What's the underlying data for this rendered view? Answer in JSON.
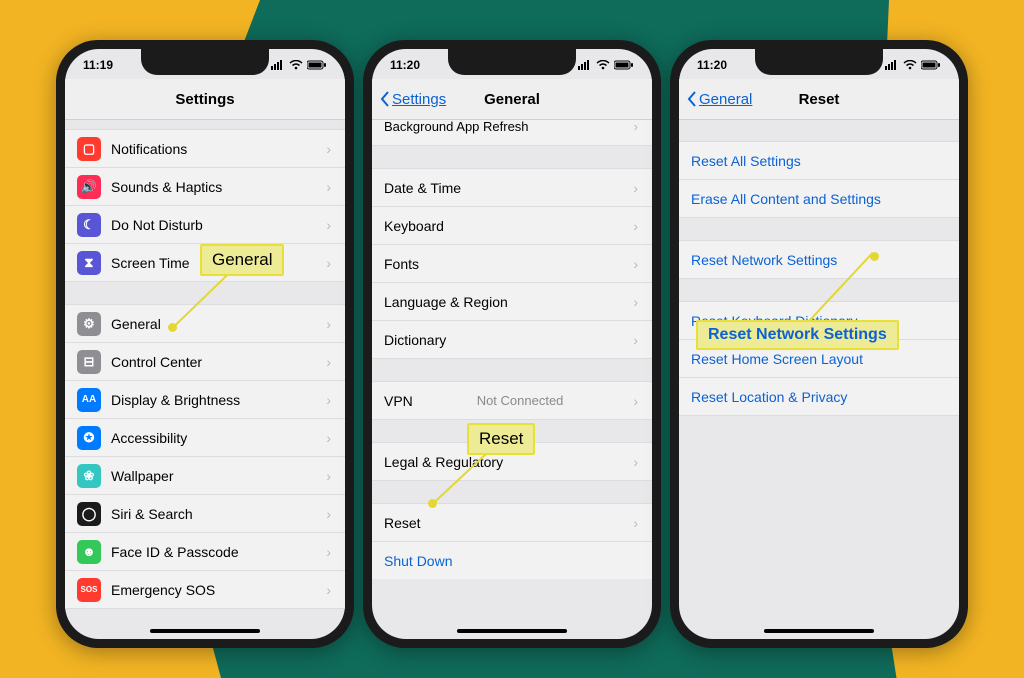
{
  "phone1": {
    "time": "11:19",
    "title": "Settings",
    "groupA": [
      {
        "label": "Notifications",
        "iconColor": "#ff3b30",
        "glyph": "◻"
      },
      {
        "label": "Sounds & Haptics",
        "iconColor": "#ff2d55",
        "glyph": "♪"
      },
      {
        "label": "Do Not Disturb",
        "iconColor": "#5856d6",
        "glyph": "☾"
      },
      {
        "label": "Screen Time",
        "iconColor": "#5856d6",
        "glyph": "⧗"
      }
    ],
    "groupB": [
      {
        "label": "General",
        "iconColor": "#8e8e93",
        "glyph": "⚙"
      },
      {
        "label": "Control Center",
        "iconColor": "#8e8e93",
        "glyph": "⊟"
      },
      {
        "label": "Display & Brightness",
        "iconColor": "#007aff",
        "glyph": "AA"
      },
      {
        "label": "Accessibility",
        "iconColor": "#007aff",
        "glyph": "✪"
      },
      {
        "label": "Wallpaper",
        "iconColor": "#34c7c2",
        "glyph": "❀"
      },
      {
        "label": "Siri & Search",
        "iconColor": "#1b1b1c",
        "glyph": "◯"
      },
      {
        "label": "Face ID & Passcode",
        "iconColor": "#34c759",
        "glyph": "☻"
      },
      {
        "label": "Emergency SOS",
        "iconColor": "#ff3b30",
        "glyph": "SOS"
      }
    ]
  },
  "phone2": {
    "time": "11:20",
    "back": "Settings",
    "title": "General",
    "rows": {
      "bg": "Background App Refresh",
      "datetime": "Date & Time",
      "keyboard": "Keyboard",
      "fonts": "Fonts",
      "lang": "Language & Region",
      "dict": "Dictionary",
      "vpn": "VPN",
      "vpnDetail": "Not Connected",
      "legal": "Legal & Regulatory",
      "reset": "Reset",
      "shutdown": "Shut Down"
    }
  },
  "phone3": {
    "time": "11:20",
    "back": "General",
    "title": "Reset",
    "rows": {
      "all": "Reset All Settings",
      "erase": "Erase All Content and Settings",
      "network": "Reset Network Settings",
      "keyboard": "Reset Keyboard Dictionary",
      "home": "Reset Home Screen Layout",
      "location": "Reset Location & Privacy"
    }
  },
  "callouts": {
    "general": "General",
    "reset": "Reset",
    "network": "Reset Network Settings"
  }
}
